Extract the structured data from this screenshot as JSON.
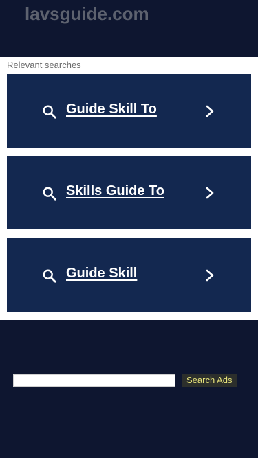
{
  "header": {
    "site_name": "lavsguide.com"
  },
  "results": {
    "section_label": "Relevant searches",
    "items": [
      {
        "label": "Guide Skill To"
      },
      {
        "label": "Skills Guide To"
      },
      {
        "label": "Guide Skill"
      }
    ]
  },
  "search": {
    "input_value": "",
    "button_label": "Search Ads"
  },
  "colors": {
    "background": "#0e1630",
    "result_card": "#132850",
    "button_text": "#e6e27a"
  },
  "icons": {
    "search": "search-icon",
    "chevron": "chevron-right-icon"
  }
}
